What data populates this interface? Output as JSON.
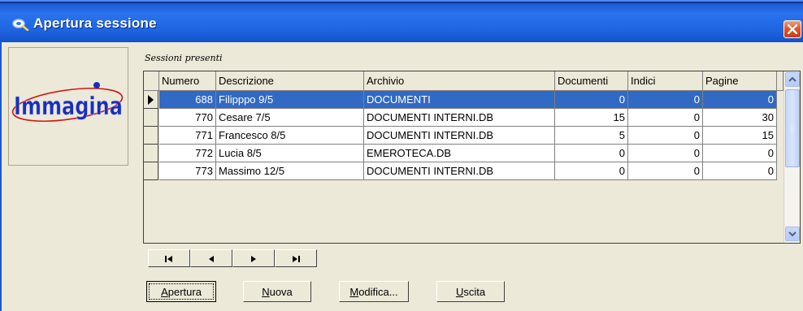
{
  "window": {
    "title": "Apertura sessione"
  },
  "logo": {
    "text": "Immagina"
  },
  "grid": {
    "caption": "Sessioni presenti",
    "columns": [
      "Numero",
      "Descrizione",
      "Archivio",
      "Documenti",
      "Indici",
      "Pagine"
    ],
    "rows": [
      {
        "numero": "688",
        "descrizione": "Filipppo 9/5",
        "archivio": "DOCUMENTI",
        "documenti": "0",
        "indici": "0",
        "pagine": "0",
        "selected": true
      },
      {
        "numero": "770",
        "descrizione": "Cesare 7/5",
        "archivio": "DOCUMENTI INTERNI.DB",
        "documenti": "15",
        "indici": "0",
        "pagine": "30"
      },
      {
        "numero": "771",
        "descrizione": "Francesco 8/5",
        "archivio": "DOCUMENTI INTERNI.DB",
        "documenti": "5",
        "indici": "0",
        "pagine": "15"
      },
      {
        "numero": "772",
        "descrizione": "Lucia 8/5",
        "archivio": "EMEROTECA.DB",
        "documenti": "0",
        "indici": "0",
        "pagine": "0"
      },
      {
        "numero": "773",
        "descrizione": "Massimo 12/5",
        "archivio": "DOCUMENTI INTERNI.DB",
        "documenti": "0",
        "indici": "0",
        "pagine": "0"
      }
    ]
  },
  "navigator": {
    "buttons": [
      "first-icon",
      "prior-icon",
      "next-icon",
      "last-icon"
    ]
  },
  "buttons": {
    "apertura": {
      "access": "A",
      "rest": "pertura"
    },
    "nuova": {
      "access": "N",
      "rest": "uova"
    },
    "modifica": {
      "access": "M",
      "rest": "odifica..."
    },
    "uscita": {
      "access": "U",
      "rest": "scita"
    }
  },
  "colors": {
    "selection": "#316ac5",
    "titlebar": "#2a73ee",
    "face": "#ece9d8",
    "logo_blue": "#1a2fb8",
    "logo_red": "#d01818"
  }
}
